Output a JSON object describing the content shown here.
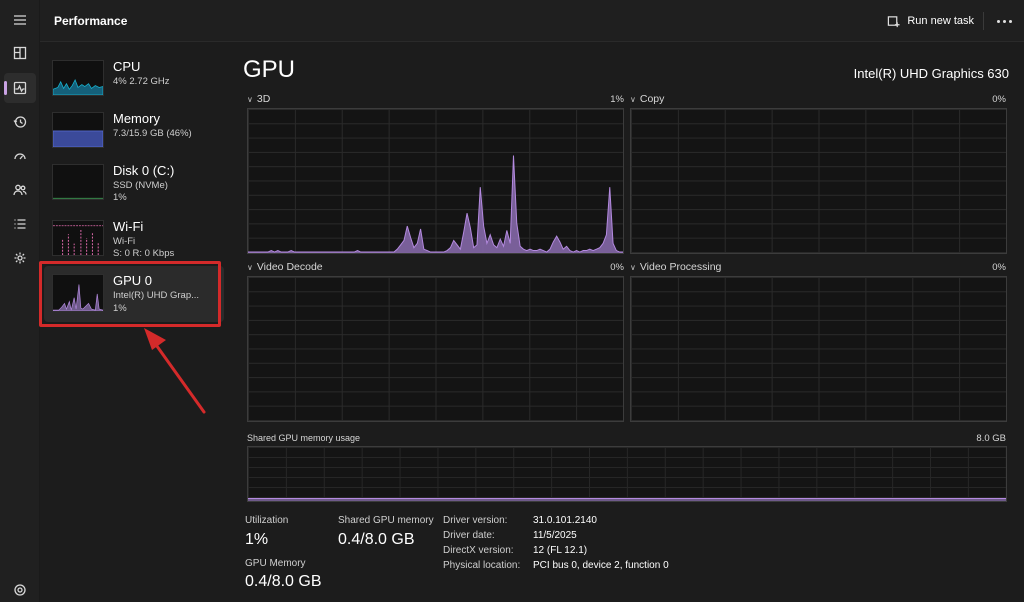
{
  "app": {
    "title": "Performance"
  },
  "header": {
    "run_new_task": "Run new task"
  },
  "rail": {
    "items": [
      "menu-icon",
      "processes-icon",
      "performance-icon",
      "app-history-icon",
      "startup-icon",
      "users-icon",
      "details-icon",
      "services-icon",
      "settings-icon"
    ],
    "active": "performance-icon"
  },
  "resources": [
    {
      "name": "CPU",
      "line1": "4%  2.72 GHz",
      "line2": ""
    },
    {
      "name": "Memory",
      "line1": "7.3/15.9 GB (46%)",
      "line2": ""
    },
    {
      "name": "Disk 0 (C:)",
      "line1": "SSD (NVMe)",
      "line2": "1%"
    },
    {
      "name": "Wi-Fi",
      "line1": "Wi-Fi",
      "line2": "S: 0  R: 0 Kbps"
    },
    {
      "name": "GPU 0",
      "line1": "Intel(R) UHD Grap...",
      "line2": "1%"
    }
  ],
  "selected_resource": "GPU 0",
  "colors": {
    "gpu_accent": "#b48ae0",
    "gpu_fill": "#8b6cb0",
    "cpu_accent": "#17b4d1",
    "memory_accent": "#5a6fd8",
    "disk_accent": "#3e9a54",
    "wifi_accent": "#e56cb0",
    "highlight_red": "#d42a2a"
  },
  "gpu": {
    "title": "GPU",
    "model": "Intel(R) UHD Graphics 630",
    "engines": [
      {
        "name": "3D",
        "percent": "1%",
        "history": [
          0,
          0,
          0,
          0,
          0,
          0,
          0,
          1,
          0,
          1,
          0,
          0,
          0,
          1,
          0,
          0,
          0,
          0,
          0,
          0,
          0,
          0,
          0,
          0,
          0,
          0,
          0,
          0,
          0,
          0,
          0,
          0,
          0,
          1,
          0,
          0,
          0,
          0,
          0,
          0,
          0,
          0,
          0,
          0,
          0,
          2,
          5,
          8,
          18,
          10,
          3,
          6,
          16,
          2,
          1,
          0,
          0,
          0,
          0,
          0,
          1,
          3,
          8,
          5,
          2,
          14,
          27,
          17,
          3,
          5,
          45,
          18,
          6,
          12,
          5,
          3,
          9,
          4,
          15,
          6,
          67,
          20,
          4,
          2,
          1,
          2,
          1,
          1,
          2,
          1,
          0,
          2,
          7,
          11,
          7,
          2,
          4,
          1,
          0,
          1,
          0,
          1,
          1,
          2,
          1,
          2,
          3,
          6,
          12,
          45,
          6,
          1,
          0,
          0
        ]
      },
      {
        "name": "Copy",
        "percent": "0%"
      },
      {
        "name": "Video Decode",
        "percent": "0%"
      },
      {
        "name": "Video Processing",
        "percent": "0%"
      }
    ],
    "shared_memory_graph": {
      "label": "Shared GPU memory usage",
      "max": "8.0 GB",
      "usage_fraction": 0.05
    },
    "stats": {
      "utilization_label": "Utilization",
      "utilization": "1%",
      "shared_memory_label": "Shared GPU memory",
      "shared_memory": "0.4/8.0 GB",
      "gpu_memory_label": "GPU Memory",
      "gpu_memory": "0.4/8.0 GB"
    },
    "info": [
      {
        "key": "Driver version:",
        "value": "31.0.101.2140"
      },
      {
        "key": "Driver date:",
        "value": "11/5/2025"
      },
      {
        "key": "DirectX version:",
        "value": "12 (FL 12.1)"
      },
      {
        "key": "Physical location:",
        "value": "PCI bus 0, device 2, function 0"
      }
    ]
  }
}
